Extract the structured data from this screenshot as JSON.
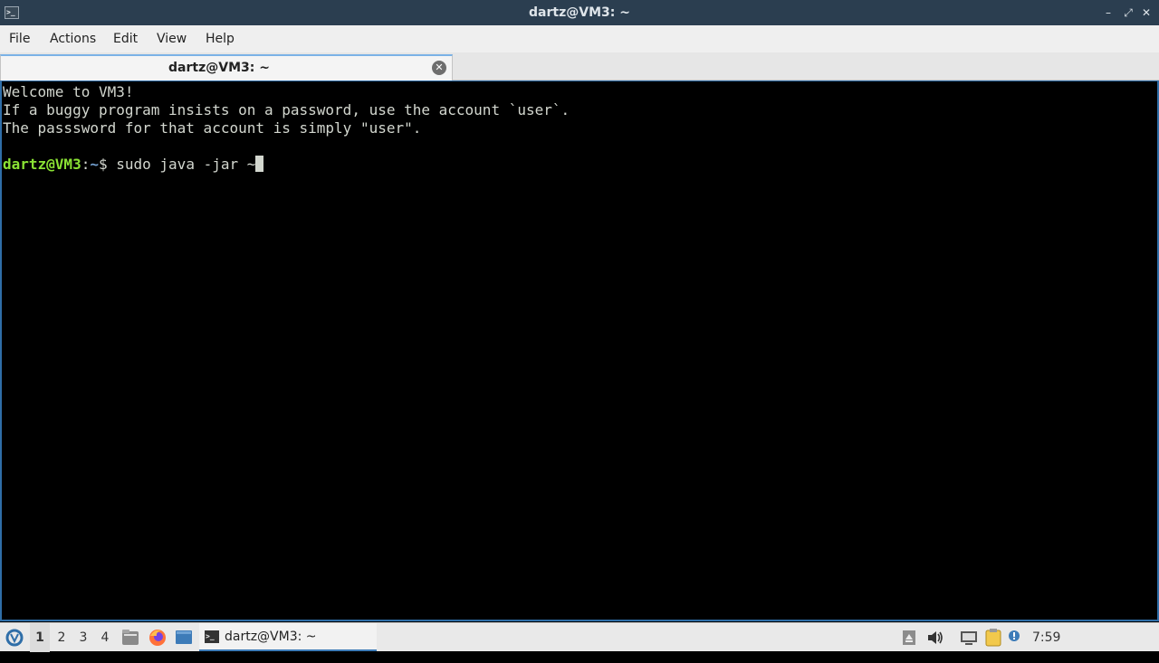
{
  "window": {
    "title": "dartz@VM3: ~",
    "app_icon": "terminal-icon",
    "controls": {
      "minimize": "–",
      "maximize": "⤢",
      "close": "✕"
    }
  },
  "menubar": {
    "items": [
      {
        "label": "File"
      },
      {
        "label": "Actions"
      },
      {
        "label": "Edit"
      },
      {
        "label": "View"
      },
      {
        "label": "Help"
      }
    ]
  },
  "tabs": [
    {
      "label": "dartz@VM3: ~",
      "active": true,
      "close_icon": "close-circle-icon"
    }
  ],
  "terminal": {
    "lines": [
      "Welcome to VM3!",
      "If a buggy program insists on a password, use the account `user`.",
      "The passsword for that account is simply \"user\".",
      ""
    ],
    "prompt": {
      "user_host": "dartz@VM3",
      "separator": ":",
      "path": "~",
      "symbol": "$ ",
      "command": "sudo java -jar ~"
    },
    "colors": {
      "user": "#8ae234",
      "path": "#729fcf",
      "text": "#d3d7cf",
      "background": "#000000"
    }
  },
  "taskbar": {
    "start_icon": "lxqt-menu-icon",
    "workspaces": [
      "1",
      "2",
      "3",
      "4"
    ],
    "active_workspace": "1",
    "quicklaunch": [
      "file-manager-icon",
      "firefox-icon",
      "show-desktop-icon"
    ],
    "task": {
      "label": "dartz@VM3: ~",
      "icon": "terminal-icon"
    },
    "tray": [
      "eject-icon",
      "volume-icon",
      "network-icon",
      "clipboard-icon",
      "update-notifier-icon"
    ],
    "clock": "7:59"
  }
}
